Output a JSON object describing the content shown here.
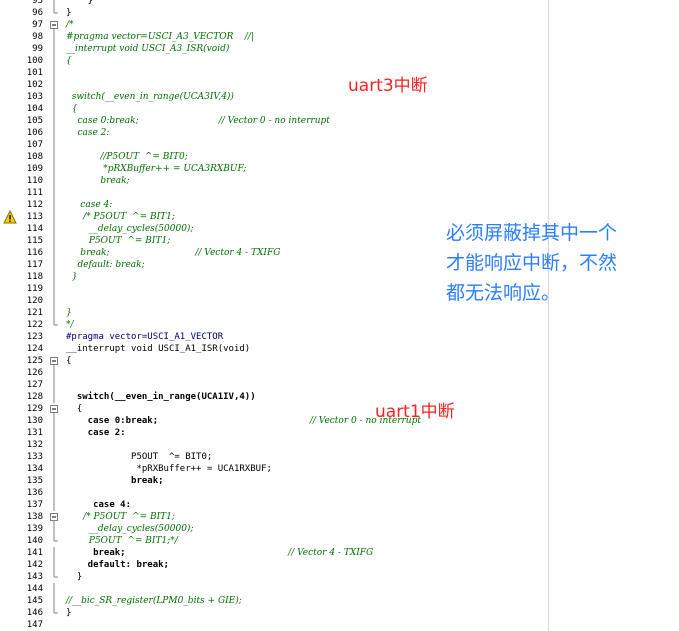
{
  "editor": {
    "lines": [
      {
        "n": "95",
        "fold": "line",
        "text": "    }",
        "style": "plain"
      },
      {
        "n": "96",
        "fold": "end",
        "text": "}",
        "style": "plain"
      },
      {
        "n": "97",
        "fold": "box",
        "text": "/*",
        "style": "comment"
      },
      {
        "n": "98",
        "fold": "line",
        "text": "#pragma vector=USCI_A3_VECTOR    //|",
        "style": "comment"
      },
      {
        "n": "99",
        "fold": "line",
        "text": "__interrupt void USCI_A3_ISR(void)",
        "style": "comment"
      },
      {
        "n": "100",
        "fold": "line",
        "text": "{",
        "style": "comment"
      },
      {
        "n": "101",
        "fold": "line",
        "text": "",
        "style": "comment"
      },
      {
        "n": "102",
        "fold": "line",
        "text": "",
        "style": "comment"
      },
      {
        "n": "103",
        "fold": "line",
        "text": "  switch(__even_in_range(UCA3IV,4))",
        "style": "comment"
      },
      {
        "n": "104",
        "fold": "line",
        "text": "  {",
        "style": "comment"
      },
      {
        "n": "105",
        "fold": "line",
        "text": "    case 0:break;                            // Vector 0 - no interrupt",
        "style": "comment"
      },
      {
        "n": "106",
        "fold": "line",
        "text": "    case 2:",
        "style": "comment"
      },
      {
        "n": "107",
        "fold": "line",
        "text": "",
        "style": "comment"
      },
      {
        "n": "108",
        "fold": "line",
        "text": "            //P5OUT  ^= BIT0;",
        "style": "comment"
      },
      {
        "n": "109",
        "fold": "line",
        "text": "             *pRXBuffer++ = UCA3RXBUF;",
        "style": "comment"
      },
      {
        "n": "110",
        "fold": "line",
        "text": "            break;",
        "style": "comment"
      },
      {
        "n": "111",
        "fold": "line",
        "text": "",
        "style": "comment"
      },
      {
        "n": "112",
        "fold": "line",
        "text": "     case 4:",
        "style": "comment"
      },
      {
        "n": "113",
        "fold": "line",
        "text": "      /* P5OUT  ^= BIT1;",
        "style": "comment",
        "warn": true
      },
      {
        "n": "114",
        "fold": "line",
        "text": "        __delay_cycles(50000);",
        "style": "comment"
      },
      {
        "n": "115",
        "fold": "line",
        "text": "        P5OUT  ^= BIT1;",
        "style": "comment"
      },
      {
        "n": "116",
        "fold": "line",
        "text": "     break;                              // Vector 4 - TXIFG",
        "style": "comment"
      },
      {
        "n": "117",
        "fold": "line",
        "text": "    default: break;",
        "style": "comment"
      },
      {
        "n": "118",
        "fold": "line",
        "text": "  }",
        "style": "comment"
      },
      {
        "n": "119",
        "fold": "line",
        "text": "",
        "style": "comment"
      },
      {
        "n": "120",
        "fold": "line",
        "text": "",
        "style": "comment"
      },
      {
        "n": "121",
        "fold": "line",
        "text": "}",
        "style": "comment"
      },
      {
        "n": "122",
        "fold": "end",
        "text": "*/",
        "style": "comment"
      },
      {
        "n": "123",
        "fold": "none",
        "text": "#pragma vector=USCI_A1_VECTOR",
        "style": "pragma"
      },
      {
        "n": "124",
        "fold": "none",
        "text": "__interrupt void USCI_A1_ISR(void)",
        "style": "isr"
      },
      {
        "n": "125",
        "fold": "box",
        "text": "{",
        "style": "plain"
      },
      {
        "n": "126",
        "fold": "line",
        "text": "",
        "style": "plain"
      },
      {
        "n": "127",
        "fold": "line",
        "text": "",
        "style": "plain"
      },
      {
        "n": "128",
        "fold": "line",
        "text": "  switch(__even_in_range(UCA1IV,4))",
        "style": "switch"
      },
      {
        "n": "129",
        "fold": "box",
        "text": "  {",
        "style": "plain"
      },
      {
        "n": "130",
        "fold": "line",
        "text": "    case 0:break;                            // Vector 0 - no interrupt",
        "style": "case-comment"
      },
      {
        "n": "131",
        "fold": "line",
        "text": "    case 2:",
        "style": "case"
      },
      {
        "n": "132",
        "fold": "line",
        "text": "",
        "style": "plain"
      },
      {
        "n": "133",
        "fold": "line",
        "text": "            P5OUT  ^= BIT0;",
        "style": "plain"
      },
      {
        "n": "134",
        "fold": "line",
        "text": "             *pRXBuffer++ = UCA1RXBUF;",
        "style": "plain"
      },
      {
        "n": "135",
        "fold": "line",
        "text": "            break;",
        "style": "bold"
      },
      {
        "n": "136",
        "fold": "line",
        "text": "",
        "style": "plain"
      },
      {
        "n": "137",
        "fold": "line",
        "text": "     case 4:",
        "style": "case"
      },
      {
        "n": "138",
        "fold": "box",
        "text": "      /* P5OUT  ^= BIT1;",
        "style": "comment"
      },
      {
        "n": "139",
        "fold": "line",
        "text": "        __delay_cycles(50000);",
        "style": "comment"
      },
      {
        "n": "140",
        "fold": "end",
        "text": "        P5OUT  ^= BIT1;*/",
        "style": "comment"
      },
      {
        "n": "141",
        "fold": "line",
        "text": "     break;                              // Vector 4 - TXIFG",
        "style": "break-comment"
      },
      {
        "n": "142",
        "fold": "line",
        "text": "    default: break;",
        "style": "default"
      },
      {
        "n": "143",
        "fold": "end",
        "text": "  }",
        "style": "plain"
      },
      {
        "n": "144",
        "fold": "line",
        "text": "",
        "style": "plain"
      },
      {
        "n": "145",
        "fold": "line",
        "text": "//__bic_SR_register(LPM0_bits + GIE);",
        "style": "comment"
      },
      {
        "n": "146",
        "fold": "end",
        "text": "}",
        "style": "plain"
      },
      {
        "n": "147",
        "fold": "none",
        "text": "",
        "style": "plain"
      }
    ]
  },
  "annotations": {
    "uart3": "uart3中断",
    "uart1": "uart1中断",
    "note": "必须屏蔽掉其中一个\n才能响应中断，不然\n都无法响应。"
  },
  "icons": {
    "warning": "warning-icon"
  },
  "colors": {
    "comment": "#007000",
    "keyword": "#000080",
    "annotation_red": "#ff2020",
    "annotation_blue": "#2a7fff",
    "warning_yellow": "#f5d000"
  }
}
